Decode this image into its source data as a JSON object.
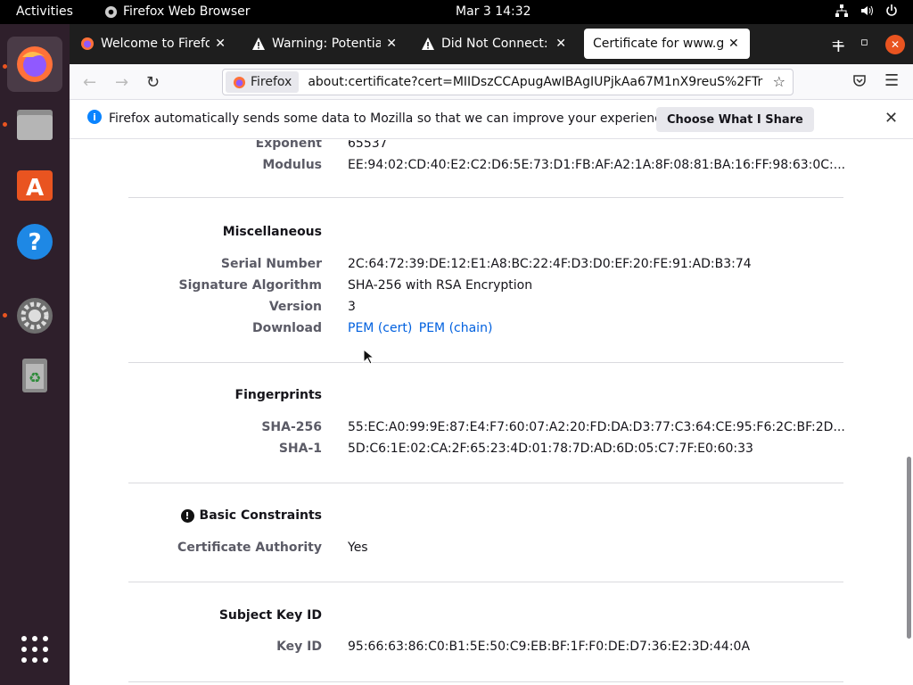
{
  "topbar": {
    "activities": "Activities",
    "app_name": "Firefox Web Browser",
    "clock": "Mar 3  14:32"
  },
  "dock": {
    "items": [
      "firefox-icon",
      "files-icon",
      "app-center-icon",
      "help-icon",
      "settings-icon",
      "trash-icon",
      "app-grid-icon"
    ]
  },
  "tabs": [
    {
      "title": "Welcome to Firefox",
      "icon": "firefox-icon"
    },
    {
      "title": "Warning: Potential S",
      "icon": "warning-icon"
    },
    {
      "title": "Did Not Connect: Po",
      "icon": "warning-icon"
    },
    {
      "title": "Certificate for www.go",
      "icon": "none"
    }
  ],
  "navbar": {
    "identity_label": "Firefox",
    "url": "about:certificate?cert=MIIDszCCApugAwIBAgIUPjkAa67M1nX9reuS%2FTr"
  },
  "notification": {
    "message": "Firefox automatically sends some data to Mozilla so that we can improve your experience.",
    "button": "Choose What I Share"
  },
  "public_key": {
    "exponent_label": "Exponent",
    "exponent": "65537",
    "modulus_label": "Modulus",
    "modulus": "EE:94:02:CD:40:E2:C2:D6:5E:73:D1:FB:AF:A2:1A:8F:08:81:BA:16:FF:98:63:0C:..."
  },
  "misc": {
    "title": "Miscellaneous",
    "serial_label": "Serial Number",
    "serial": "2C:64:72:39:DE:12:E1:A8:BC:22:4F:D3:D0:EF:20:FE:91:AD:B3:74",
    "sigalg_label": "Signature Algorithm",
    "sigalg": "SHA-256 with RSA Encryption",
    "version_label": "Version",
    "version": "3",
    "download_label": "Download",
    "pem_cert": "PEM (cert)",
    "pem_chain": "PEM (chain)"
  },
  "fingerprints": {
    "title": "Fingerprints",
    "sha256_label": "SHA-256",
    "sha256": "55:EC:A0:99:9E:87:E4:F7:60:07:A2:20:FD:DA:D3:77:C3:64:CE:95:F6:2C:BF:2D...",
    "sha1_label": "SHA-1",
    "sha1": "5D:C6:1E:02:CA:2F:65:23:4D:01:78:7D:AD:6D:05:C7:7F:E0:60:33"
  },
  "basic_constraints": {
    "title": "Basic Constraints",
    "ca_label": "Certificate Authority",
    "ca": "Yes"
  },
  "subject_key": {
    "title": "Subject Key ID",
    "keyid_label": "Key ID",
    "keyid": "95:66:63:86:C0:B1:5E:50:C9:EB:BF:1F:F0:DE:D7:36:E2:3D:44:0A"
  },
  "colors": {
    "accent": "#e95420",
    "link": "#0060df",
    "dock": "#2e1f2b"
  }
}
